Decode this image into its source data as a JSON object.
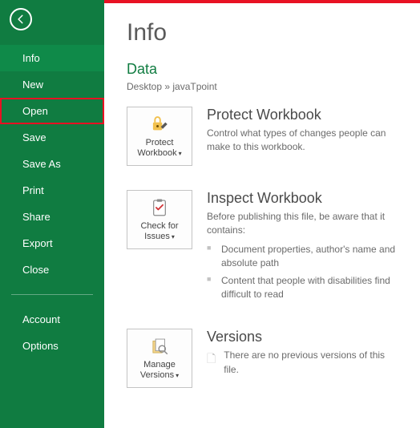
{
  "sidebar": {
    "items": [
      {
        "label": "Info",
        "active": true,
        "highlight": false
      },
      {
        "label": "New"
      },
      {
        "label": "Open",
        "highlight": true
      },
      {
        "label": "Save"
      },
      {
        "label": "Save As"
      },
      {
        "label": "Print"
      },
      {
        "label": "Share"
      },
      {
        "label": "Export"
      },
      {
        "label": "Close"
      }
    ],
    "footer": [
      {
        "label": "Account"
      },
      {
        "label": "Options"
      }
    ]
  },
  "page": {
    "title": "Info",
    "docName": "Data",
    "breadcrumb": "Desktop » javaTpoint"
  },
  "sections": {
    "protect": {
      "tileLabel": "Protect Workbook",
      "title": "Protect Workbook",
      "desc": "Control what types of changes people can make to this workbook."
    },
    "inspect": {
      "tileLabel": "Check for Issues",
      "title": "Inspect Workbook",
      "desc": "Before publishing this file, be aware that it contains:",
      "bullets": [
        "Document properties, author's name and absolute path",
        "Content that people with disabilities find difficult to read"
      ]
    },
    "versions": {
      "tileLabel": "Manage Versions",
      "title": "Versions",
      "desc": "There are no previous versions of this file."
    }
  }
}
